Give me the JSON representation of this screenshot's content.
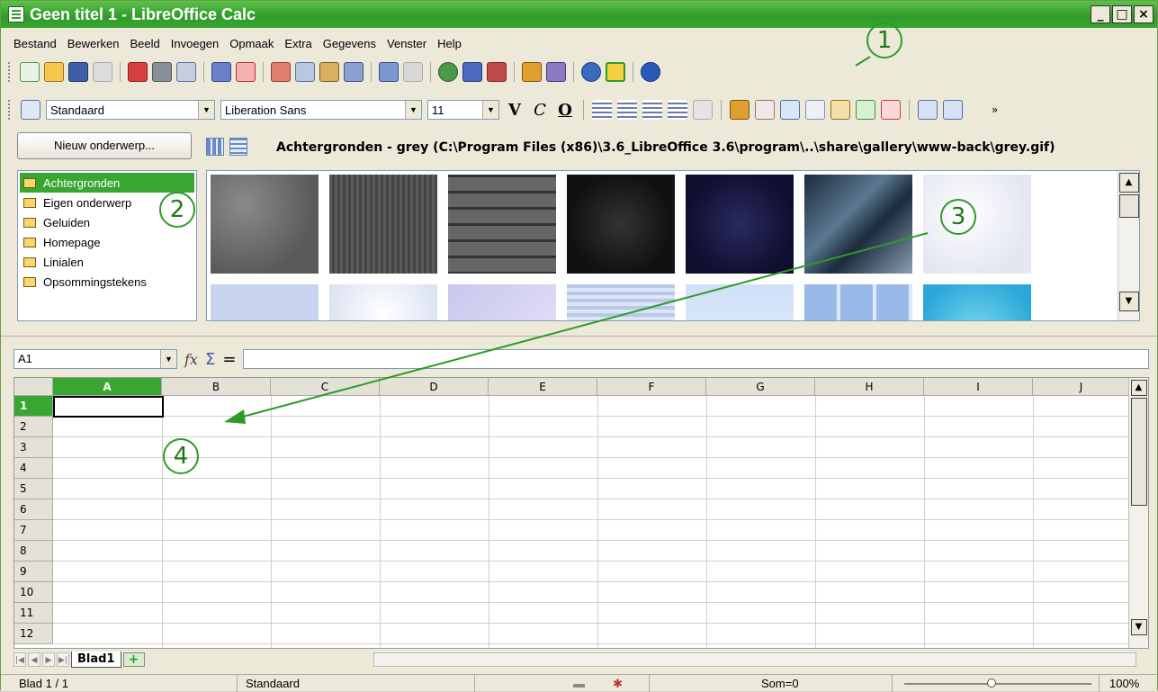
{
  "window": {
    "title": "Geen titel 1 - LibreOffice Calc",
    "controls": [
      "_",
      "□",
      "×"
    ]
  },
  "menu": [
    "Bestand",
    "Bewerken",
    "Beeld",
    "Invoegen",
    "Opmaak",
    "Extra",
    "Gegevens",
    "Venster",
    "Help"
  ],
  "format_toolbar": {
    "style": "Standaard",
    "font": "Liberation Sans",
    "size": "11",
    "bold": "V",
    "italic": "C",
    "underline": "O",
    "overflow": "»"
  },
  "gallery": {
    "new_topic_label": "Nieuw onderwerp...",
    "path": "Achtergronden - grey (C:\\Program Files (x86)\\3.6_LibreOffice 3.6\\program\\..\\share\\gallery\\www-back\\grey.gif)",
    "topics": [
      "Achtergronden",
      "Eigen onderwerp",
      "Geluiden",
      "Homepage",
      "Linialen",
      "Opsommingstekens"
    ],
    "selected_topic": "Achtergronden",
    "thumbnail_rows": [
      [
        "grey",
        "dark-grey",
        "brick",
        "black",
        "navy",
        "marble",
        "snow"
      ],
      [
        "light-blue",
        "dots",
        "lavender",
        "waves",
        "sky",
        "tiles",
        "water"
      ]
    ]
  },
  "formula_bar": {
    "cell_ref": "A1",
    "function_wizard": "fx",
    "sum_symbol": "Σ",
    "equals_symbol": "="
  },
  "sheet": {
    "columns": [
      "A",
      "B",
      "C",
      "D",
      "E",
      "F",
      "G",
      "H",
      "I",
      "J"
    ],
    "rows": [
      "1",
      "2",
      "3",
      "4",
      "5",
      "6",
      "7",
      "8",
      "9",
      "10",
      "11",
      "12"
    ],
    "active_cell": "A1",
    "tab": "Blad1",
    "add_tab": "+"
  },
  "status": {
    "page": "Blad 1 / 1",
    "style": "Standaard",
    "sum": "Som=0",
    "zoom": "100%"
  },
  "callouts": [
    "1",
    "2",
    "3",
    "4"
  ],
  "colors": {
    "accent": "#3aa632",
    "callout": "#2f9a2a"
  }
}
